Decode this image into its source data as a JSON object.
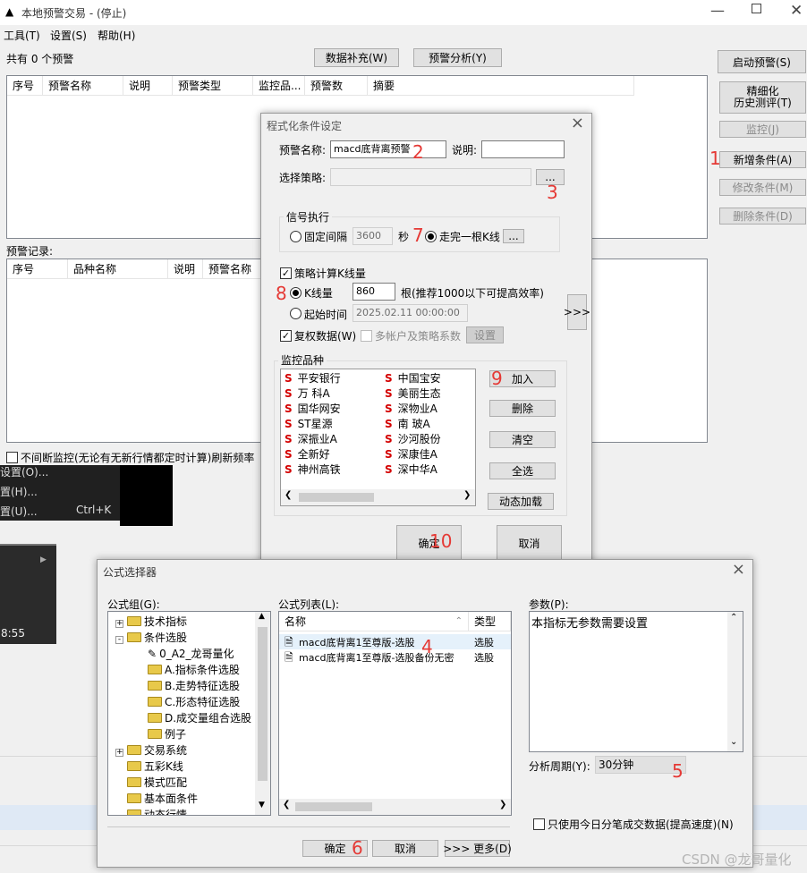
{
  "main_window": {
    "title": "本地预警交易  - (停止)",
    "menu": [
      "工具(T)",
      "设置(S)",
      "帮助(H)"
    ],
    "count_text": "共有 0 个预警",
    "data_supplement_btn": "数据补充(W)",
    "alert_analysis_btn": "预警分析(Y)",
    "alert_columns": [
      "序号",
      "预警名称",
      "说明",
      "预警类型",
      "监控品...",
      "预警数",
      "摘要"
    ],
    "records_label": "预警记录:",
    "record_columns": [
      "序号",
      "品种名称",
      "说明",
      "预警名称"
    ],
    "continuous_monitor_text": "不间断监控(无论有无新行情都定时计算)刷新频率",
    "right_buttons": {
      "start": "启动预警(S)",
      "refine_line1": "精细化",
      "refine_line2": "历史测评(T)",
      "monitor": "监控(J)",
      "add_condition": "新增条件(A)",
      "modify_condition": "修改条件(M)",
      "delete_condition": "删除条件(D)"
    }
  },
  "bg_menu": {
    "item1": "设置(O)...",
    "item2": "置(H)...",
    "item3": "置(U)...",
    "item3_shortcut": "Ctrl+K",
    "time": "8:55"
  },
  "cond_dialog": {
    "title": "程式化条件设定",
    "name_label": "预警名称:",
    "name_value": "macd底背离预警",
    "desc_label": "说明:",
    "desc_value": "",
    "strategy_label": "选择策略:",
    "strategy_value": "",
    "browse_btn": "...",
    "signal_group": "信号执行",
    "fixed_interval": "固定间隔",
    "interval_value": "3600",
    "seconds": "秒",
    "finish_kline": "走完一根K线",
    "finish_btn": "...",
    "strategy_kline": "策略计算K线量",
    "kline_count_label": "K线量",
    "kline_count_value": "860",
    "kline_hint": "根(推荐1000以下可提高效率)",
    "start_time_label": "起始时间",
    "start_time_value": "2025.02.11 00:00:00",
    "adjusted_data": "复权数据(W)",
    "multi_account": "多帐户及策略系数",
    "settings_btn": "设置",
    "expand_btn": ">>>",
    "monitor_group": "监控品种",
    "stocks_left": [
      "平安银行",
      "万  科A",
      "国华网安",
      "ST星源",
      "深振业A",
      "全新好",
      "神州高铁"
    ],
    "stocks_right": [
      "中国宝安",
      "美丽生态",
      "深物业A",
      "南  玻A",
      "沙河股份",
      "深康佳A",
      "深中华A"
    ],
    "add_btn": "加入",
    "delete_btn": "删除",
    "clear_btn": "清空",
    "select_all_btn": "全选",
    "dynamic_load_btn": "动态加载",
    "ok_btn": "确定",
    "cancel_btn": "取消"
  },
  "formula_dialog": {
    "title": "公式选择器",
    "group_label": "公式组(G):",
    "list_label": "公式列表(L):",
    "params_label": "参数(P):",
    "params_text": "本指标无参数需要设置",
    "tree": [
      {
        "label": "技术指标",
        "level": 0,
        "expander": "+"
      },
      {
        "label": "条件选股",
        "level": 0,
        "expander": "-"
      },
      {
        "label": "0_A2_龙哥量化",
        "level": 1,
        "icon": "pencil"
      },
      {
        "label": "A.指标条件选股",
        "level": 1
      },
      {
        "label": "B.走势特征选股",
        "level": 1
      },
      {
        "label": "C.形态特征选股",
        "level": 1
      },
      {
        "label": "D.成交量组合选股",
        "level": 1
      },
      {
        "label": "例子",
        "level": 1
      },
      {
        "label": "交易系统",
        "level": 0,
        "expander": "+"
      },
      {
        "label": "五彩K线",
        "level": 0
      },
      {
        "label": "模式匹配",
        "level": 0
      },
      {
        "label": "基本面条件",
        "level": 0
      },
      {
        "label": "动态行情",
        "level": 0
      }
    ],
    "list_columns": [
      "名称",
      "类型"
    ],
    "list_items": [
      {
        "name": "macd底背离1至尊版-选股",
        "type": "选股"
      },
      {
        "name": "macd底背离1至尊版-选股备份无密",
        "type": "选股"
      }
    ],
    "period_label": "分析周期(Y):",
    "period_value": "30分钟",
    "tick_checkbox": "只使用今日分笔成交数据(提高速度)(N)",
    "ok_btn": "确定",
    "cancel_btn": "取消",
    "more_btn": ">>> 更多(D)"
  },
  "annotations": [
    "1",
    "2",
    "3",
    "4",
    "5",
    "6",
    "7",
    "8",
    "9",
    "10"
  ],
  "watermark": "CSDN @龙哥量化",
  "colors": {
    "annotation": "#e53935",
    "selected_row": "#e5f1fb"
  }
}
